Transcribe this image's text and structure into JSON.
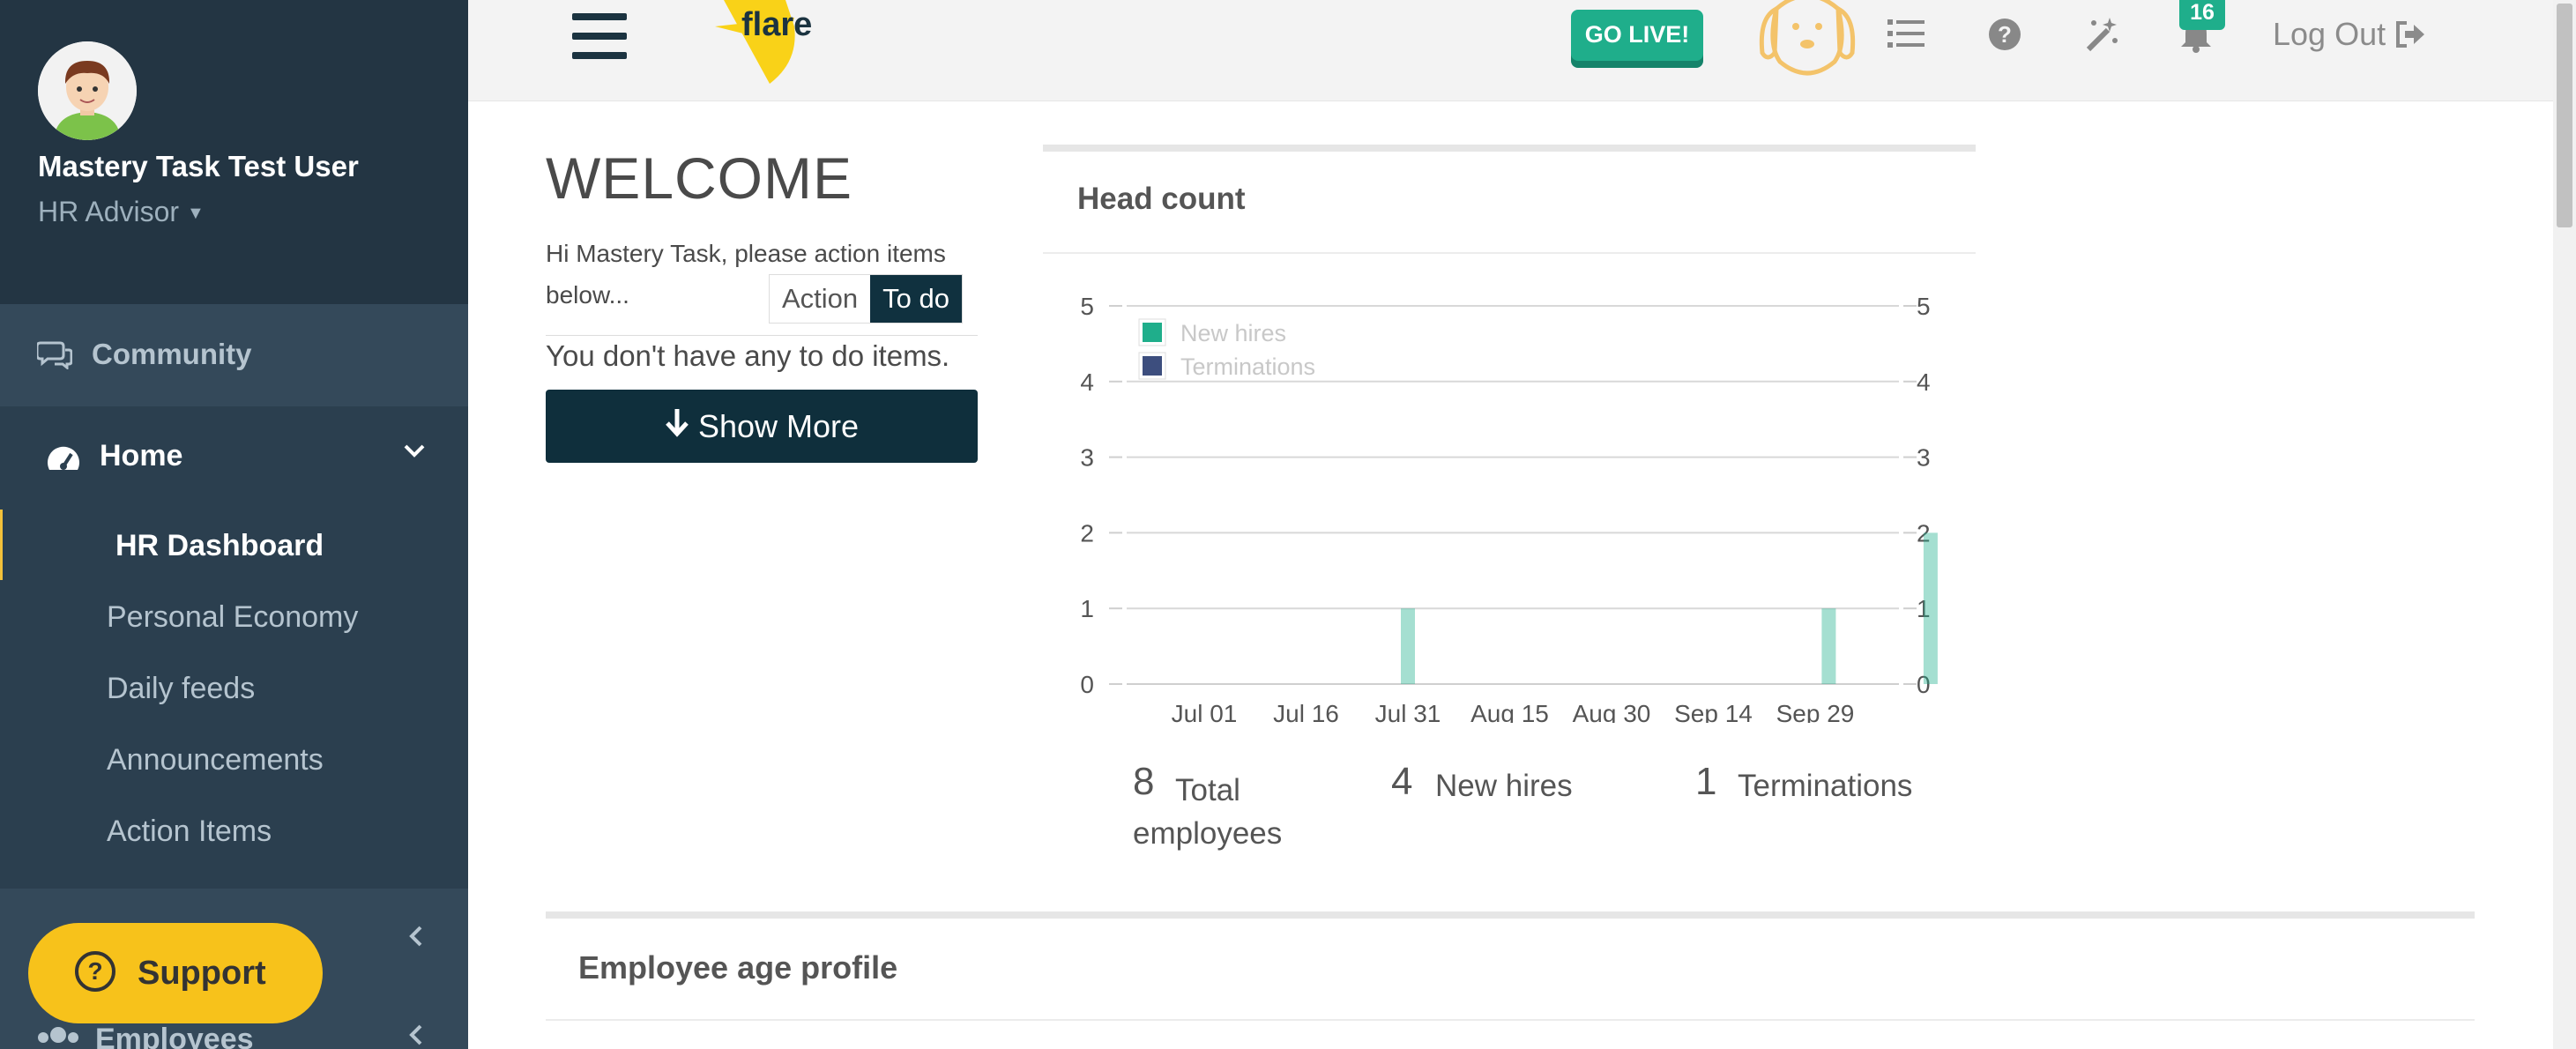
{
  "sidebar": {
    "user_name": "Mastery Task Test User",
    "user_role": "HR Advisor",
    "community_label": "Community",
    "home_label": "Home",
    "home_items": [
      "HR Dashboard",
      "Personal Economy",
      "Daily feeds",
      "Announcements",
      "Action Items"
    ],
    "employees_label": "Employees",
    "support_label": "Support"
  },
  "topbar": {
    "logo_text": "flare",
    "golive_label": "GO LIVE!",
    "notifications_count": "16",
    "logout_label": "Log Out"
  },
  "welcome": {
    "title": "WELCOME",
    "greeting": "Hi Mastery Task, please action items below...",
    "toggle_action": "Action",
    "toggle_todo": "To do",
    "no_todo": "You don't have any to do items.",
    "show_more": "Show More"
  },
  "headcount": {
    "title": "Head count",
    "stats": [
      {
        "value": "8",
        "label": "Total employees"
      },
      {
        "value": "4",
        "label": "New hires"
      },
      {
        "value": "1",
        "label": "Terminations"
      }
    ]
  },
  "age_profile": {
    "title": "Employee age profile"
  },
  "colors": {
    "new_hires": "#1fae8b",
    "terminations": "#3d4e7e",
    "sidebar_bg": "#2b3f4f",
    "accent_dark": "#0f2f3c",
    "support": "#f7c21b"
  },
  "chart_data": {
    "type": "bar",
    "x_tick_labels": [
      "Jul 01",
      "Jul 16",
      "Jul 31",
      "Aug 15",
      "Aug 30",
      "Sep 14",
      "Sep 29"
    ],
    "y_ticks": [
      0,
      1,
      2,
      3,
      4,
      5
    ],
    "ylim": [
      0,
      5
    ],
    "legend": [
      "New hires",
      "Terminations"
    ],
    "legend_position": "top-left",
    "grid": true,
    "series": [
      {
        "name": "New hires",
        "points": [
          {
            "x": "Jul 31",
            "y": 1
          },
          {
            "x": "Oct 01",
            "y": 1
          },
          {
            "x": "Oct 16",
            "y": 2
          }
        ]
      },
      {
        "name": "Terminations",
        "points": []
      }
    ]
  }
}
